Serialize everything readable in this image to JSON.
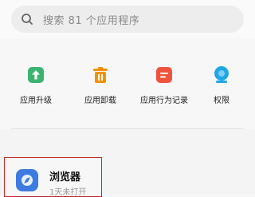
{
  "search": {
    "placeholder": "搜索 81 个应用程序",
    "icon": "search-icon"
  },
  "grid": [
    {
      "label": "应用升级",
      "icon": "upgrade-arrow-icon",
      "color": "#3bb46e"
    },
    {
      "label": "应用卸载",
      "icon": "trash-icon",
      "color": "#f29200"
    },
    {
      "label": "应用行为记录",
      "icon": "record-icon",
      "color": "#f0533d"
    },
    {
      "label": "权限",
      "icon": "permission-icon",
      "color": "#1ea7e8"
    }
  ],
  "app_card": {
    "name": "浏览器",
    "subtitle": "1天未打开",
    "icon": "browser-icon",
    "highlight_color": "#c62828"
  }
}
